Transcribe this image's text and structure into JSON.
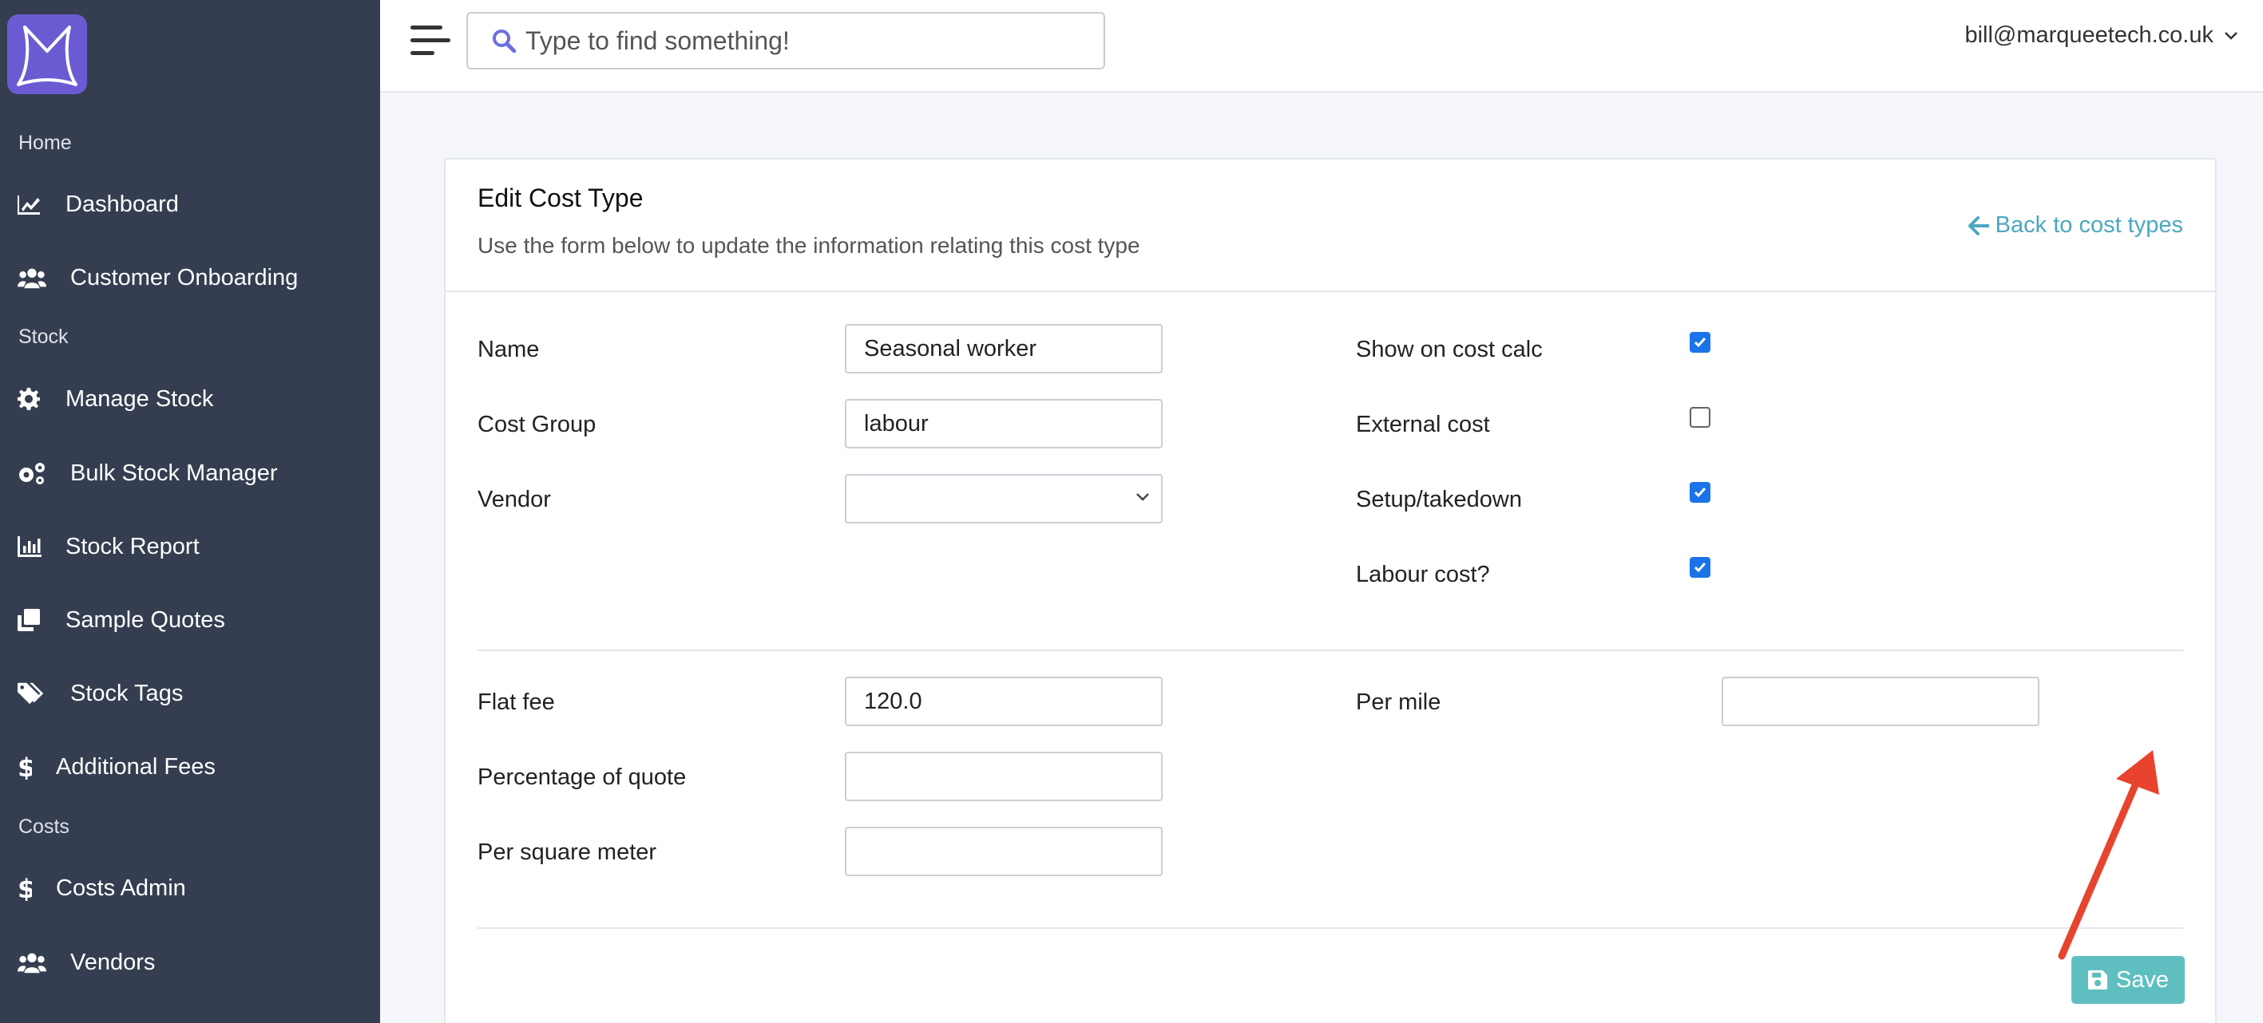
{
  "sidebar": {
    "sections": [
      {
        "label": "Home"
      },
      {
        "label": "Stock"
      },
      {
        "label": "Costs"
      }
    ],
    "items": [
      {
        "label": "Dashboard",
        "icon": "chart-line-icon"
      },
      {
        "label": "Customer Onboarding",
        "icon": "users-icon"
      },
      {
        "label": "Manage Stock",
        "icon": "gear-icon"
      },
      {
        "label": "Bulk Stock Manager",
        "icon": "gears-icon"
      },
      {
        "label": "Stock Report",
        "icon": "bar-chart-icon"
      },
      {
        "label": "Sample Quotes",
        "icon": "copy-icon"
      },
      {
        "label": "Stock Tags",
        "icon": "tags-icon"
      },
      {
        "label": "Additional Fees",
        "icon": "dollar-icon"
      },
      {
        "label": "Costs Admin",
        "icon": "dollar-icon"
      },
      {
        "label": "Vendors",
        "icon": "users-icon"
      }
    ]
  },
  "topbar": {
    "search_placeholder": "Type to find something!",
    "user_email": "bill@marqueetech.co.uk"
  },
  "card": {
    "title": "Edit Cost Type",
    "subtitle": "Use the form below to update the information relating this cost type",
    "back_link": "Back to cost types"
  },
  "form": {
    "name": {
      "label": "Name",
      "value": "Seasonal worker"
    },
    "cost_group": {
      "label": "Cost Group",
      "value": "labour"
    },
    "vendor": {
      "label": "Vendor",
      "value": ""
    },
    "show_on_cost_calc": {
      "label": "Show on cost calc",
      "checked": true
    },
    "external_cost": {
      "label": "External cost",
      "checked": false
    },
    "setup_takedown": {
      "label": "Setup/takedown",
      "checked": true
    },
    "labour_cost": {
      "label": "Labour cost?",
      "checked": true
    },
    "flat_fee": {
      "label": "Flat fee",
      "value": "120.0"
    },
    "percentage_of_quote": {
      "label": "Percentage of quote",
      "value": ""
    },
    "per_square_meter": {
      "label": "Per square meter",
      "value": ""
    },
    "per_mile": {
      "label": "Per mile",
      "value": ""
    },
    "save_label": "Save"
  },
  "colors": {
    "sidebar_bg": "#343e50",
    "logo_bg": "#6b5bd2",
    "link": "#4ba8c2",
    "save_button": "#5fbfc0",
    "checkbox": "#1a73e8",
    "annotation_arrow": "#e8432e"
  }
}
